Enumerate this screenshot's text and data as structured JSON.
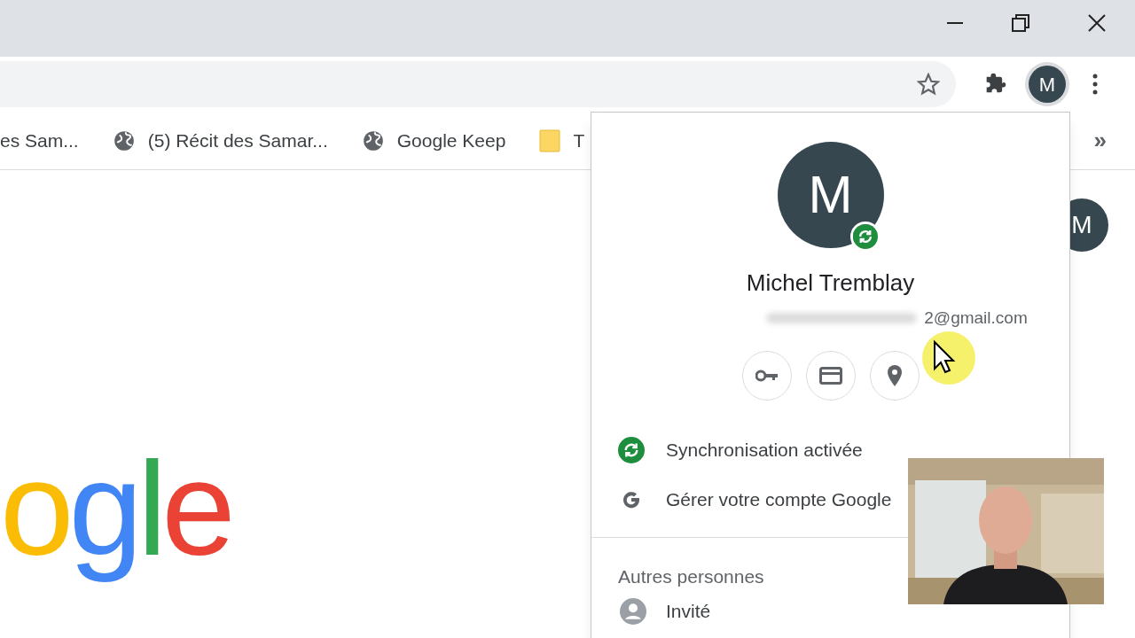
{
  "toolbar": {
    "avatar_letter": "M"
  },
  "bookmarks": [
    {
      "label": "es Sam...",
      "kind": "plain"
    },
    {
      "label": "(5) Récit des Samar...",
      "kind": "globe"
    },
    {
      "label": "Google Keep",
      "kind": "globe"
    },
    {
      "label": "T",
      "kind": "folder"
    }
  ],
  "bookmarks_overflow": "»",
  "page": {
    "logo": [
      {
        "letter": "o",
        "color": "#fbbc05"
      },
      {
        "letter": "g",
        "color": "#4285f4"
      },
      {
        "letter": "l",
        "color": "#34a853"
      },
      {
        "letter": "e",
        "color": "#ea4335"
      }
    ],
    "avatar_letter": "M"
  },
  "profile_menu": {
    "avatar_letter": "M",
    "sync_on": true,
    "name": "Michel Tremblay",
    "email": "2@gmail.com",
    "actions": [
      {
        "kind": "key"
      },
      {
        "kind": "card"
      },
      {
        "kind": "pin"
      }
    ],
    "items": [
      {
        "kind": "sync",
        "label": "Synchronisation activée"
      },
      {
        "kind": "google",
        "label": "Gérer votre compte Google"
      }
    ],
    "other_heading": "Autres personnes",
    "people": [
      {
        "label": "Invité"
      }
    ]
  }
}
